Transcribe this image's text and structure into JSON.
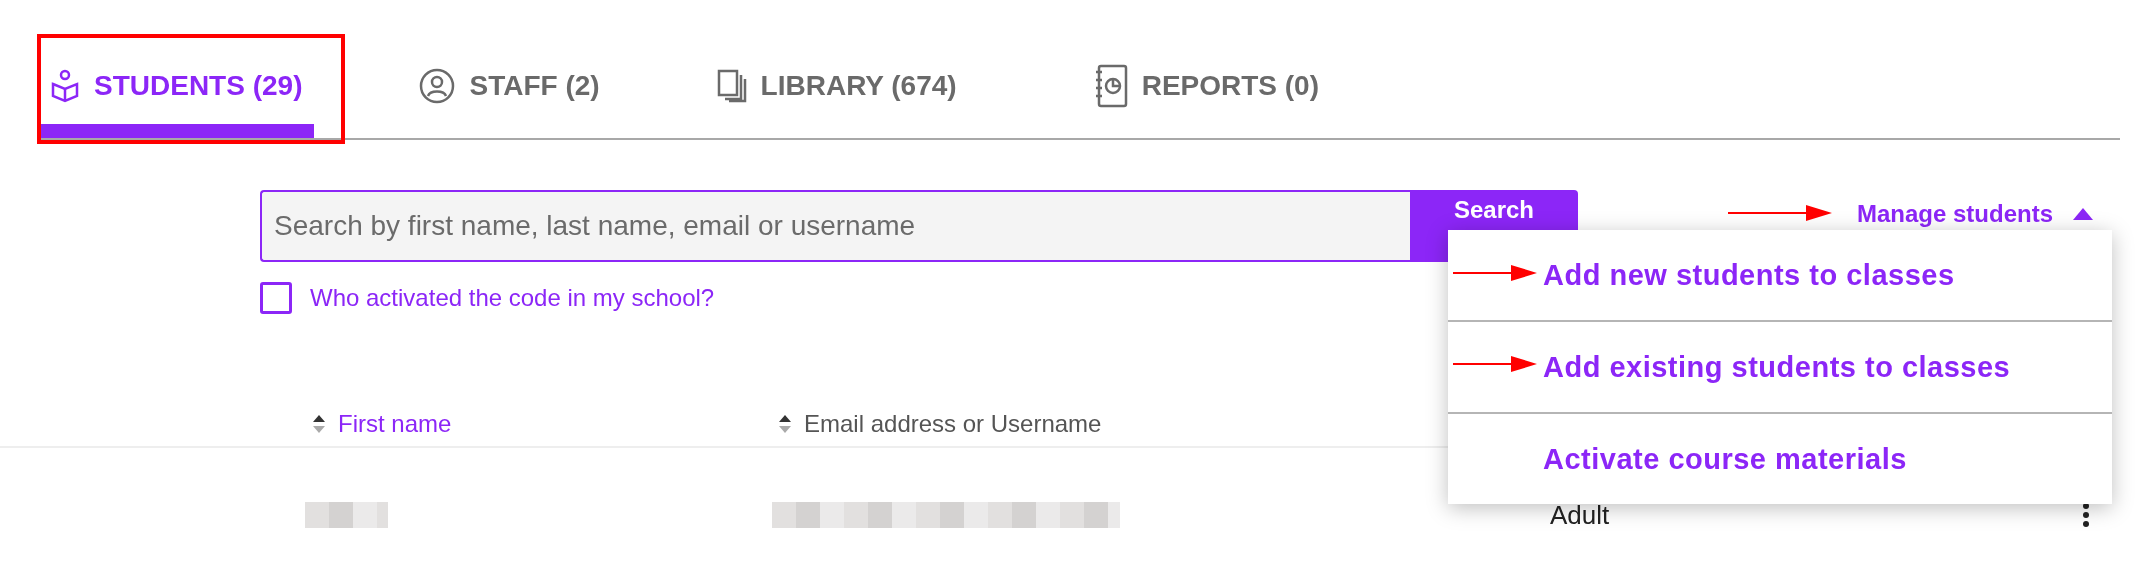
{
  "tabs": [
    {
      "label": "STUDENTS (29)",
      "selected": true
    },
    {
      "label": "STAFF (2)",
      "selected": false
    },
    {
      "label": "LIBRARY (674)",
      "selected": false
    },
    {
      "label": "REPORTS (0)",
      "selected": false
    }
  ],
  "search": {
    "placeholder": "Search by first name, last name, email or username",
    "button": "Search"
  },
  "filter_checkbox": {
    "label": "Who activated the code in my school?",
    "checked": false
  },
  "manage_menu": {
    "label": "Manage students",
    "expanded": true,
    "items": [
      {
        "label": "Add new students to classes"
      },
      {
        "label": "Add existing students to classes"
      },
      {
        "label": "Activate course materials"
      }
    ]
  },
  "table": {
    "columns": [
      {
        "label": "First name",
        "active": true
      },
      {
        "label": "Email address or Username",
        "active": false
      }
    ],
    "rows": [
      {
        "cells": [
          {
            "kind": "redacted"
          },
          {
            "kind": "redacted"
          },
          {
            "kind": "text",
            "text": "Adult"
          }
        ]
      }
    ]
  }
}
